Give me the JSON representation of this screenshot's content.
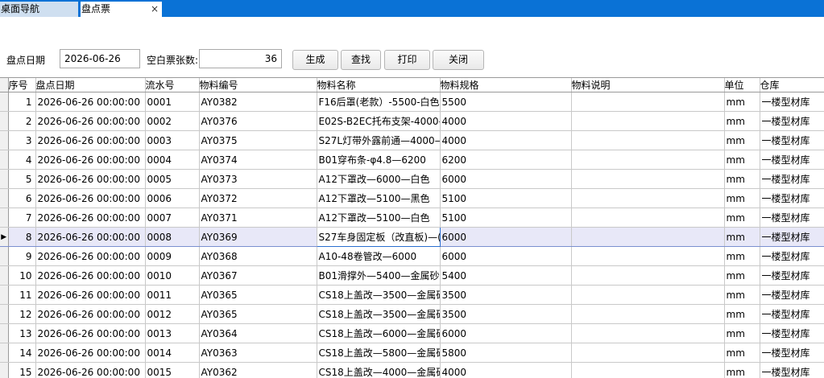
{
  "tabs": [
    {
      "label": "桌面导航"
    },
    {
      "label": "盘点票",
      "close": "×"
    }
  ],
  "toolbar": {
    "date_label": "盘点日期",
    "date_value": "2026-06-26",
    "blank_label": "空白票张数:",
    "blank_value": "36",
    "buttons": [
      "生成",
      "查找",
      "打印",
      "关闭"
    ]
  },
  "table": {
    "current_marker": "▶",
    "current_row": 8,
    "columns": [
      "序号",
      "盘点日期",
      "流水号",
      "物料编号",
      "物料名称",
      "物料规格",
      "物料说明",
      "单位",
      "仓库"
    ],
    "rows": [
      [
        "1",
        "2026-06-26 00:00:00",
        "0001",
        "AY0382",
        "F16后罩(老款）-5500-白色",
        "5500",
        "",
        "mm",
        "一楼型材库"
      ],
      [
        "2",
        "2026-06-26 00:00:00",
        "0002",
        "AY0376",
        "E02S-B2EC托布支架-4000-",
        "4000",
        "",
        "mm",
        "一楼型材库"
      ],
      [
        "3",
        "2026-06-26 00:00:00",
        "0003",
        "AY0375",
        "S27L灯带外露前通—4000—",
        "4000",
        "",
        "mm",
        "一楼型材库"
      ],
      [
        "4",
        "2026-06-26 00:00:00",
        "0004",
        "AY0374",
        "B01穿布条-φ4.8—6200",
        "6200",
        "",
        "mm",
        "一楼型材库"
      ],
      [
        "5",
        "2026-06-26 00:00:00",
        "0005",
        "AY0373",
        "A12下罩改—6000—白色",
        "6000",
        "",
        "mm",
        "一楼型材库"
      ],
      [
        "6",
        "2026-06-26 00:00:00",
        "0006",
        "AY0372",
        "A12下罩改—5100—黑色",
        "5100",
        "",
        "mm",
        "一楼型材库"
      ],
      [
        "7",
        "2026-06-26 00:00:00",
        "0007",
        "AY0371",
        "A12下罩改—5100—白色",
        "5100",
        "",
        "mm",
        "一楼型材库"
      ],
      [
        "8",
        "2026-06-26 00:00:00",
        "0008",
        "AY0369",
        "S27车身固定板（改直板)—(",
        "6000",
        "",
        "mm",
        "一楼型材库"
      ],
      [
        "9",
        "2026-06-26 00:00:00",
        "0009",
        "AY0368",
        "A10-48卷管改—6000",
        "6000",
        "",
        "mm",
        "一楼型材库"
      ],
      [
        "10",
        "2026-06-26 00:00:00",
        "0010",
        "AY0367",
        "B01滑撑外—5400—金属砂",
        "5400",
        "",
        "mm",
        "一楼型材库"
      ],
      [
        "11",
        "2026-06-26 00:00:00",
        "0011",
        "AY0365",
        "CS18上盖改—3500—金属砂",
        "3500",
        "",
        "mm",
        "一楼型材库"
      ],
      [
        "12",
        "2026-06-26 00:00:00",
        "0012",
        "AY0365",
        "CS18上盖改—3500—金属砂",
        "3500",
        "",
        "mm",
        "一楼型材库"
      ],
      [
        "13",
        "2026-06-26 00:00:00",
        "0013",
        "AY0364",
        "CS18上盖改—6000—金属砂",
        "6000",
        "",
        "mm",
        "一楼型材库"
      ],
      [
        "14",
        "2026-06-26 00:00:00",
        "0014",
        "AY0363",
        "CS18上盖改—5800—金属砂",
        "5800",
        "",
        "mm",
        "一楼型材库"
      ],
      [
        "15",
        "2026-06-26 00:00:00",
        "0015",
        "AY0362",
        "CS18上盖改—4000—金属砂",
        "4000",
        "",
        "mm",
        "一楼型材库"
      ]
    ]
  }
}
